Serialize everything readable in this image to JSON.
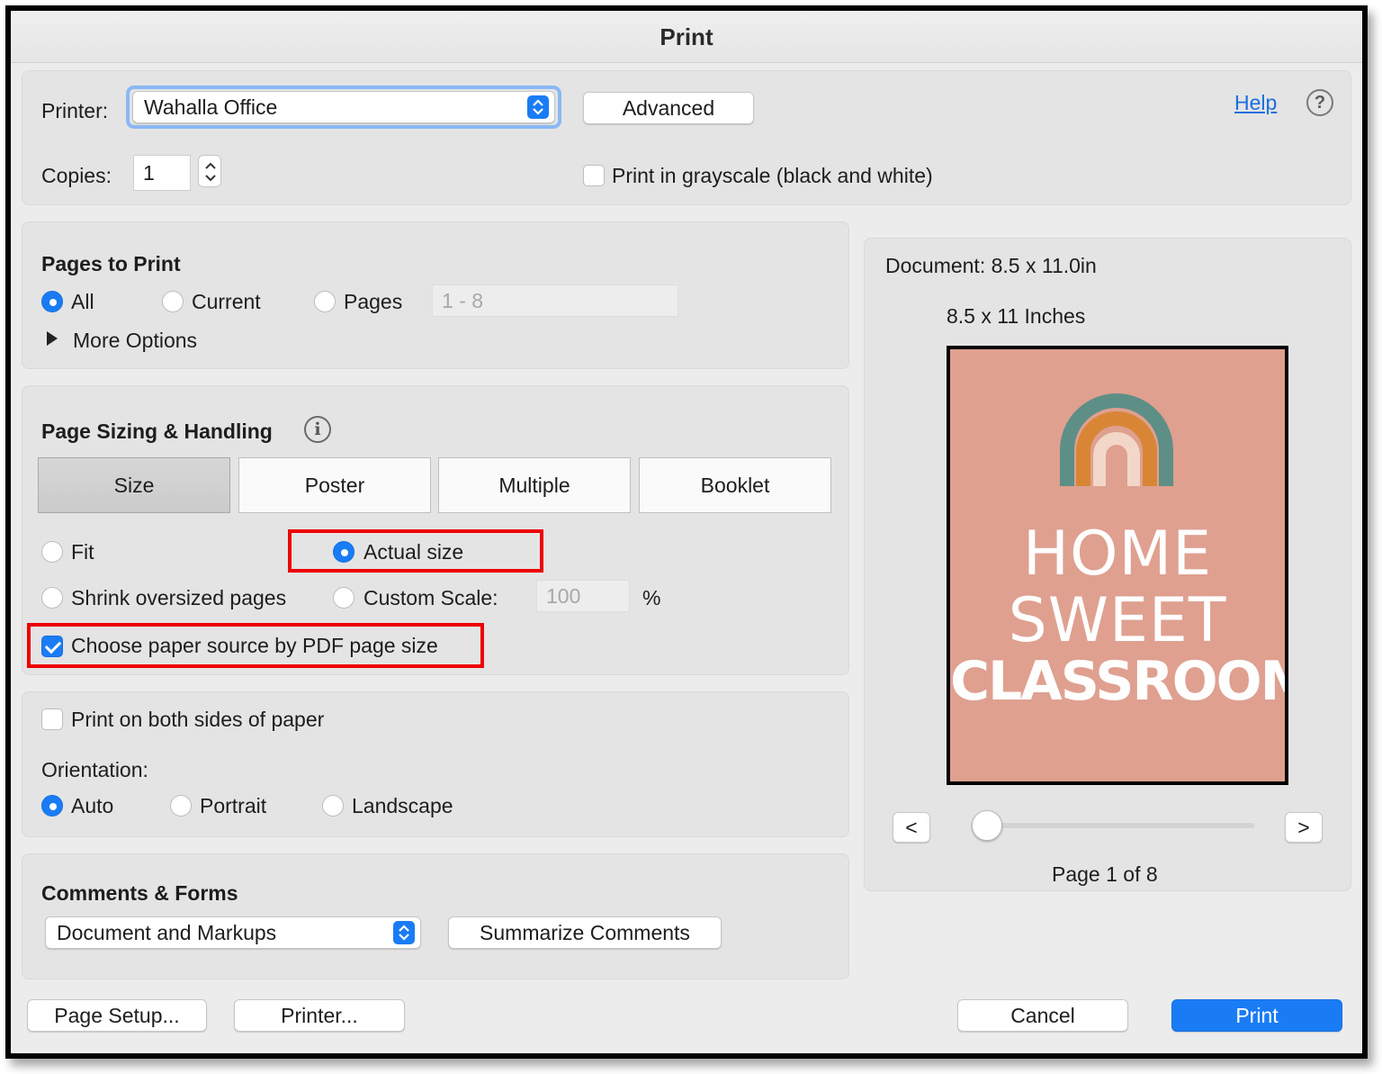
{
  "window": {
    "title": "Print"
  },
  "printer": {
    "label": "Printer:",
    "selected": "Wahalla Office",
    "advanced_button": "Advanced",
    "help_link": "Help",
    "help_icon": "question-circle-icon",
    "copies_label": "Copies:",
    "copies_value": "1",
    "grayscale_label": "Print in grayscale (black and white)",
    "grayscale_checked": false
  },
  "pages_to_print": {
    "title": "Pages to Print",
    "options": {
      "all": "All",
      "current": "Current",
      "pages": "Pages"
    },
    "selected": "All",
    "pages_range_placeholder": "1 - 8",
    "more_options": "More Options"
  },
  "page_sizing": {
    "title": "Page Sizing & Handling",
    "info_icon": "info-icon",
    "tabs": [
      "Size",
      "Poster",
      "Multiple",
      "Booklet"
    ],
    "selected_tab": "Size",
    "fit_label": "Fit",
    "actual_size_label": "Actual size",
    "shrink_label": "Shrink oversized pages",
    "custom_scale_label": "Custom Scale:",
    "custom_scale_value": "100",
    "percent_label": "%",
    "selected_option": "Actual size",
    "paper_source_label": "Choose paper source by PDF page size",
    "paper_source_checked": true
  },
  "duplex": {
    "both_sides_label": "Print on both sides of paper",
    "both_sides_checked": false,
    "orientation_label": "Orientation:",
    "orientation_options": {
      "auto": "Auto",
      "portrait": "Portrait",
      "landscape": "Landscape"
    },
    "selected": "Auto"
  },
  "comments_forms": {
    "title": "Comments & Forms",
    "selected": "Document and Markups",
    "summarize_button": "Summarize Comments"
  },
  "preview": {
    "document_label": "Document: 8.5 x 11.0in",
    "size_label": "8.5 x 11 Inches",
    "poster_lines": [
      "HOME",
      "SWEET",
      "CLASSROOM"
    ],
    "prev_button": "<",
    "next_button": ">",
    "page_indicator": "Page 1 of 8",
    "slider_page": 1,
    "page_count": 8,
    "page_color": "#dfa090"
  },
  "footer": {
    "page_setup_button": "Page Setup...",
    "printer_button": "Printer...",
    "cancel_button": "Cancel",
    "print_button": "Print"
  },
  "colors": {
    "accent": "#1a7cf5",
    "highlight": "#ee0000"
  }
}
